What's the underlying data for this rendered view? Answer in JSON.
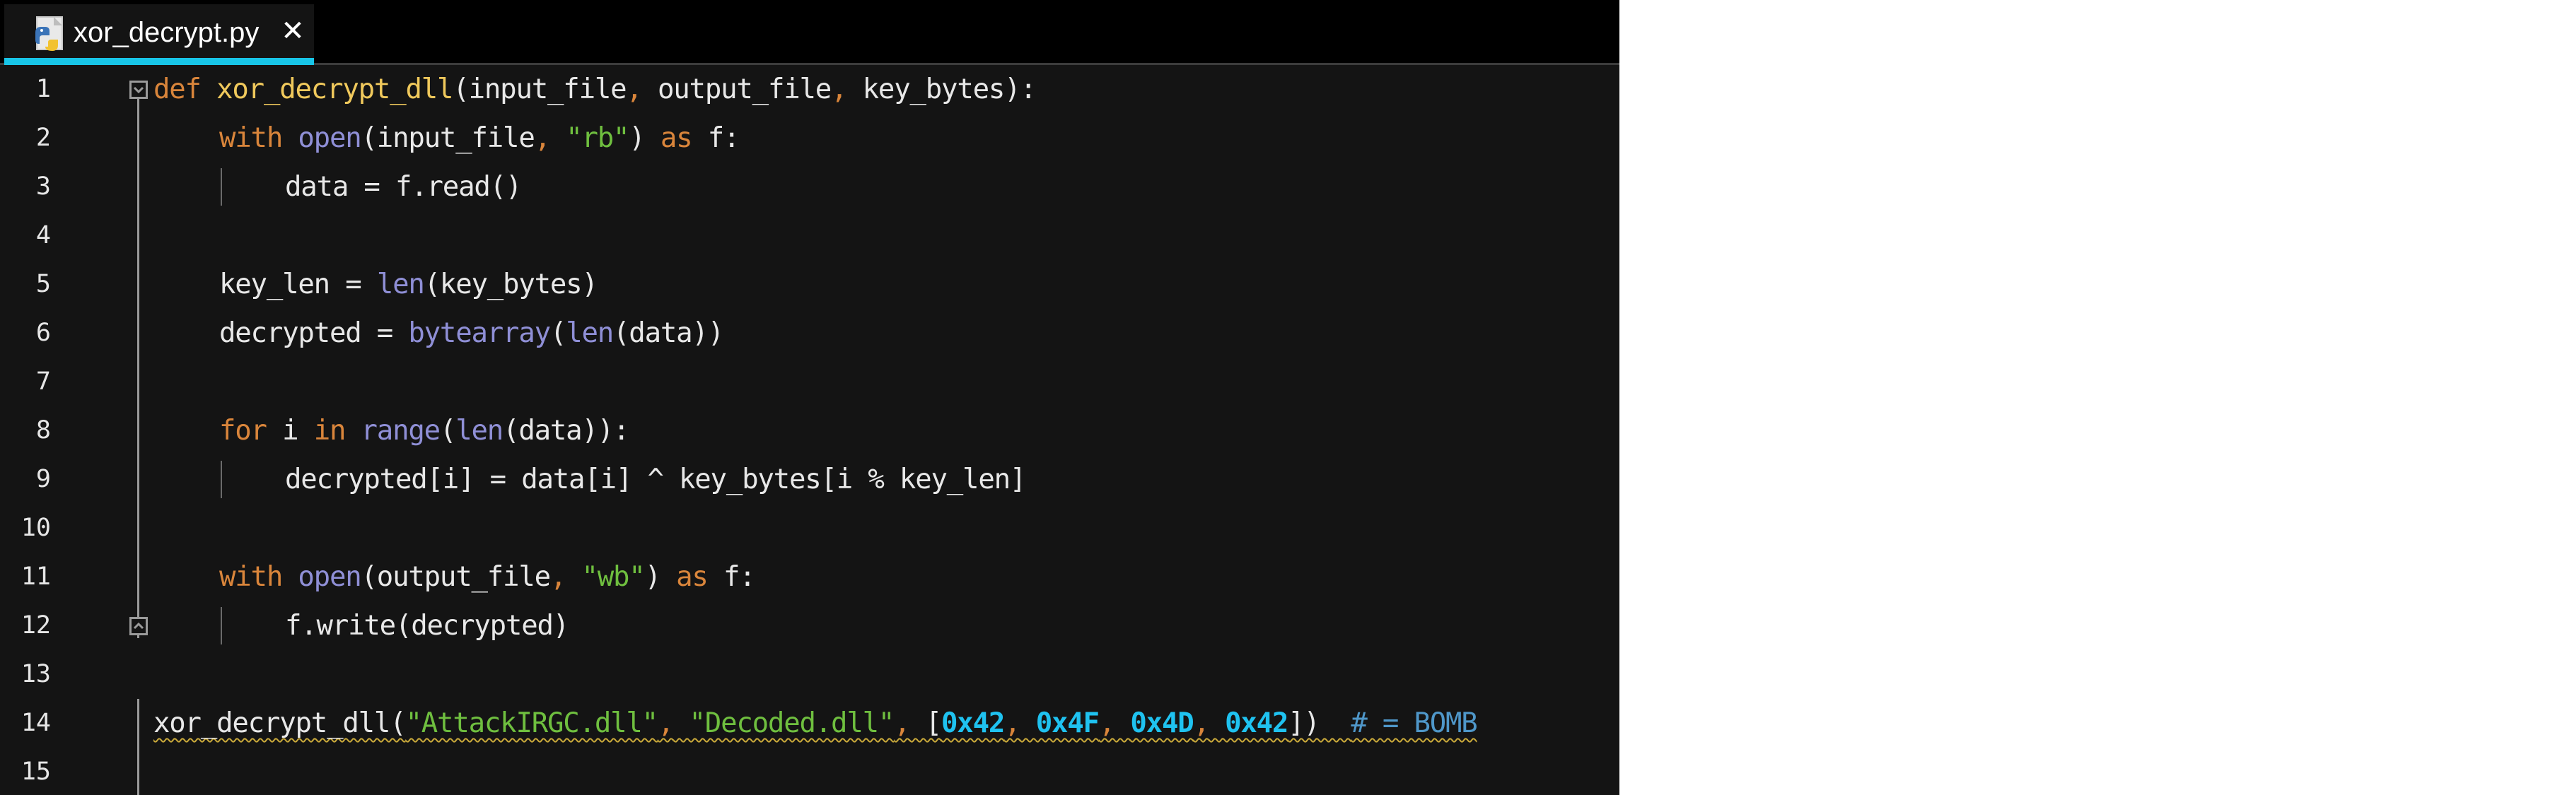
{
  "tab": {
    "title": "xor_decrypt.py",
    "close_glyph": "✕",
    "icon": "python-file-icon"
  },
  "colors": {
    "keyword": "#d9853b",
    "function_name": "#f0c95c",
    "builtin": "#8f8fd6",
    "string": "#6fbf3f",
    "number": "#1fc2f0",
    "comment": "#4f97c9",
    "text": "#e8e8e8",
    "tab_accent": "#18c5e8"
  },
  "code": {
    "lines": [
      {
        "n": "1",
        "tokens": [
          {
            "t": "def",
            "c": "kw"
          },
          {
            "t": " "
          },
          {
            "t": "xor_decrypt_dll",
            "c": "fn"
          },
          {
            "t": "(input_file"
          },
          {
            "t": ",",
            "c": "op"
          },
          {
            "t": " output_file"
          },
          {
            "t": ",",
            "c": "op"
          },
          {
            "t": " key_bytes):"
          }
        ]
      },
      {
        "n": "2",
        "tokens": [
          {
            "t": "with",
            "c": "kw"
          },
          {
            "t": " "
          },
          {
            "t": "open",
            "c": "bi"
          },
          {
            "t": "(input_file"
          },
          {
            "t": ",",
            "c": "op"
          },
          {
            "t": " "
          },
          {
            "t": "\"rb\"",
            "c": "st"
          },
          {
            "t": ") "
          },
          {
            "t": "as",
            "c": "kw"
          },
          {
            "t": " f:"
          }
        ]
      },
      {
        "n": "3",
        "tokens": [
          {
            "t": "data = f.read()"
          }
        ]
      },
      {
        "n": "4",
        "tokens": []
      },
      {
        "n": "5",
        "tokens": [
          {
            "t": "key_len = "
          },
          {
            "t": "len",
            "c": "bi"
          },
          {
            "t": "(key_bytes)"
          }
        ]
      },
      {
        "n": "6",
        "tokens": [
          {
            "t": "decrypted = "
          },
          {
            "t": "bytearray",
            "c": "bi"
          },
          {
            "t": "("
          },
          {
            "t": "len",
            "c": "bi"
          },
          {
            "t": "(data))"
          }
        ]
      },
      {
        "n": "7",
        "tokens": []
      },
      {
        "n": "8",
        "tokens": [
          {
            "t": "for",
            "c": "kw"
          },
          {
            "t": " i "
          },
          {
            "t": "in",
            "c": "kw"
          },
          {
            "t": " "
          },
          {
            "t": "range",
            "c": "bi"
          },
          {
            "t": "("
          },
          {
            "t": "len",
            "c": "bi"
          },
          {
            "t": "(data)):"
          }
        ]
      },
      {
        "n": "9",
        "tokens": [
          {
            "t": "decrypted[i] = data[i] ^ key_bytes[i % key_len]"
          }
        ]
      },
      {
        "n": "10",
        "tokens": []
      },
      {
        "n": "11",
        "tokens": [
          {
            "t": "with",
            "c": "kw"
          },
          {
            "t": " "
          },
          {
            "t": "open",
            "c": "bi"
          },
          {
            "t": "(output_file"
          },
          {
            "t": ",",
            "c": "op"
          },
          {
            "t": " "
          },
          {
            "t": "\"wb\"",
            "c": "st"
          },
          {
            "t": ") "
          },
          {
            "t": "as",
            "c": "kw"
          },
          {
            "t": " f:"
          }
        ]
      },
      {
        "n": "12",
        "tokens": [
          {
            "t": "f.write(decrypted)"
          }
        ]
      },
      {
        "n": "13",
        "tokens": []
      },
      {
        "n": "14",
        "tokens": [
          {
            "t": "xor_decrypt_dll("
          },
          {
            "t": "\"AttackIRGC.dll\"",
            "c": "st"
          },
          {
            "t": ",",
            "c": "op"
          },
          {
            "t": " "
          },
          {
            "t": "\"Decoded.dll\"",
            "c": "st"
          },
          {
            "t": ",",
            "c": "op"
          },
          {
            "t": " ["
          },
          {
            "t": "0x42",
            "c": "nu"
          },
          {
            "t": ",",
            "c": "op"
          },
          {
            "t": " "
          },
          {
            "t": "0x4F",
            "c": "nu"
          },
          {
            "t": ",",
            "c": "op"
          },
          {
            "t": " "
          },
          {
            "t": "0x4D",
            "c": "nu"
          },
          {
            "t": ",",
            "c": "op"
          },
          {
            "t": " "
          },
          {
            "t": "0x42",
            "c": "nu"
          },
          {
            "t": "])  "
          },
          {
            "t": "# = BOMB",
            "c": "cm"
          }
        ]
      },
      {
        "n": "15",
        "tokens": []
      }
    ]
  }
}
